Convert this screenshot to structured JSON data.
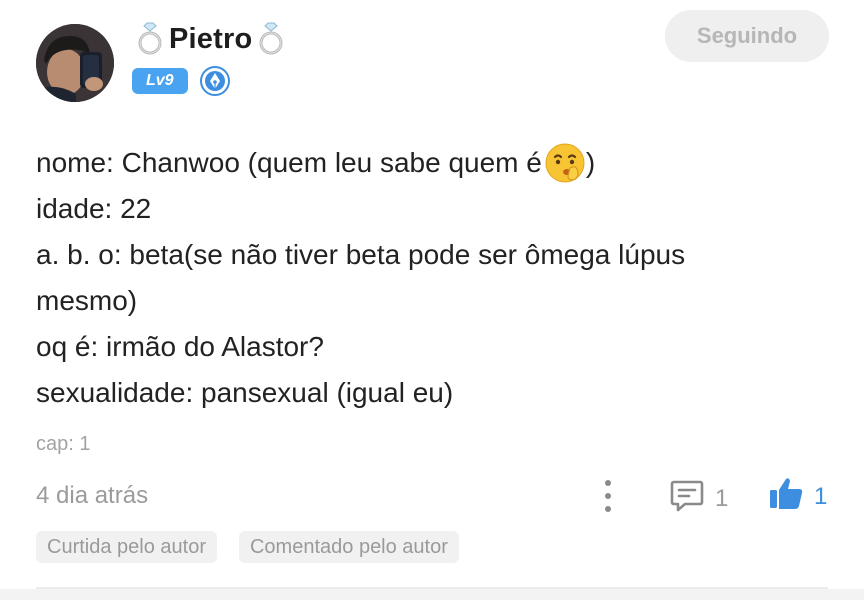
{
  "author": {
    "name": "Pietro",
    "decoration_icon": "ring-icon",
    "level": "Lv9",
    "title_icon": "fountain-pen-badge-icon"
  },
  "header": {
    "follow_label": "Seguindo"
  },
  "post": {
    "lines": [
      "nome: Chanwoo (quem leu sabe quem é",
      "idade: 22",
      "a. b. o: beta(se não tiver beta pode ser ômega lúpus",
      "mesmo)",
      "oq é: irmão do Alastor?",
      "sexualidade: pansexual (igual eu)"
    ],
    "line1_close": ")",
    "emoji": "shushing-face-emoji",
    "caption": "cap: 1"
  },
  "footer": {
    "timestamp": "4 dia atrás",
    "comment_count": "1",
    "like_count": "1",
    "tags": [
      "Curtida pelo autor",
      "Comentado pelo autor"
    ]
  },
  "colors": {
    "accent": "#3d8ee0",
    "level_badge": "#4aa3f0",
    "muted_text": "#9b9b9b",
    "follow_bg": "#efefef"
  }
}
